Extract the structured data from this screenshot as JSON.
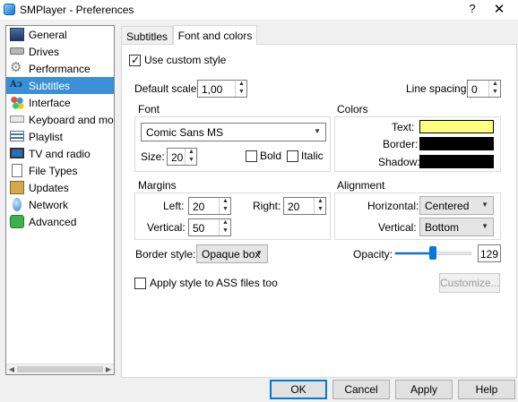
{
  "window": {
    "title": "SMPlayer - Preferences",
    "help_label": "?",
    "close_label": "✕"
  },
  "sidebar": {
    "items": [
      {
        "label": "General",
        "icon": "general-icon"
      },
      {
        "label": "Drives",
        "icon": "drives-icon"
      },
      {
        "label": "Performance",
        "icon": "performance-icon"
      },
      {
        "label": "Subtitles",
        "icon": "subtitles-icon",
        "selected": true
      },
      {
        "label": "Interface",
        "icon": "interface-icon"
      },
      {
        "label": "Keyboard and mouse",
        "icon": "keyboard-icon"
      },
      {
        "label": "Playlist",
        "icon": "playlist-icon"
      },
      {
        "label": "TV and radio",
        "icon": "tv-icon"
      },
      {
        "label": "File Types",
        "icon": "filetypes-icon"
      },
      {
        "label": "Updates",
        "icon": "updates-icon"
      },
      {
        "label": "Network",
        "icon": "network-icon"
      },
      {
        "label": "Advanced",
        "icon": "advanced-icon"
      }
    ]
  },
  "tabs": [
    {
      "label": "Subtitles",
      "active": false
    },
    {
      "label": "Font and colors",
      "active": true
    }
  ],
  "font_colors": {
    "use_custom_style_label": "Use custom style",
    "use_custom_style_checked": true,
    "default_scale_label": "Default scale:",
    "default_scale_value": "1,00",
    "line_spacing_label": "Line spacing:",
    "line_spacing_value": "0",
    "font_group_label": "Font",
    "font_value": "Comic Sans MS",
    "size_label": "Size:",
    "size_value": "20",
    "bold_label": "Bold",
    "italic_label": "Italic",
    "colors_group_label": "Colors",
    "text_color_label": "Text:",
    "text_color": "#ffff80",
    "border_color_label": "Border:",
    "border_color": "#000000",
    "shadow_color_label": "Shadow:",
    "shadow_color": "#000000",
    "margins_group_label": "Margins",
    "left_label": "Left:",
    "left_value": "20",
    "right_label": "Right:",
    "right_value": "20",
    "vertical_margin_label": "Vertical:",
    "vertical_margin_value": "50",
    "alignment_group_label": "Alignment",
    "horizontal_label": "Horizontal:",
    "horizontal_value": "Centered",
    "vertical_align_label": "Vertical:",
    "vertical_align_value": "Bottom",
    "border_style_label": "Border style:",
    "border_style_value": "Opaque box",
    "opacity_label": "Opacity:",
    "opacity_value": "129",
    "opacity_max": 255,
    "apply_ass_label": "Apply style to ASS files too",
    "customize_label": "Customize..."
  },
  "buttons": {
    "ok": "OK",
    "cancel": "Cancel",
    "apply": "Apply",
    "help": "Help"
  }
}
